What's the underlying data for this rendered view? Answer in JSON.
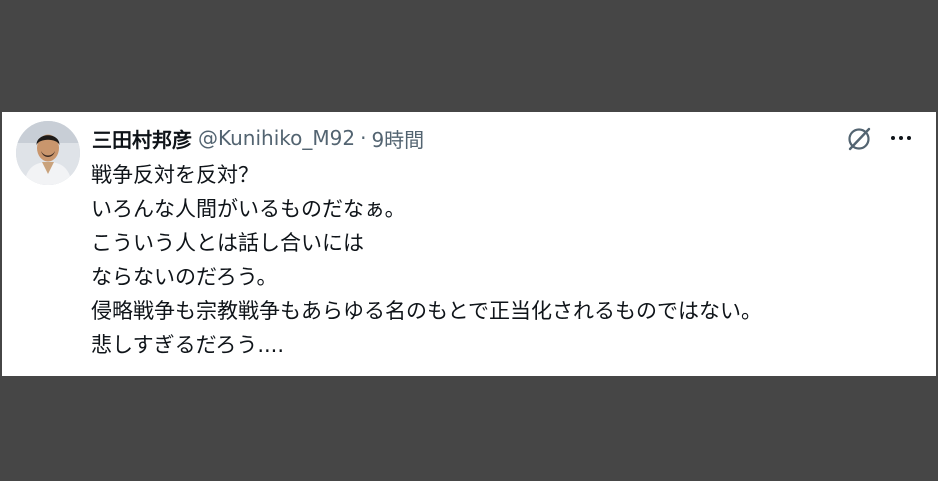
{
  "tweet": {
    "author": {
      "display_name": "三田村邦彦",
      "handle": "@Kunihiko_M92"
    },
    "separator": "·",
    "timestamp": "9時間",
    "lines": [
      "戦争反対を反対？",
      "いろんな人間がいるものだなぁ。",
      "こういう人とは話し合いには",
      "ならないのだろう。",
      "侵略戦争も宗教戦争もあらゆる名のもとで正当化されるものではない。",
      "悲しすぎるだろう...."
    ],
    "icons": {
      "grok": "grok-icon",
      "more": "more-options-icon"
    },
    "colors": {
      "background": "#464646",
      "card": "#ffffff",
      "text": "#0f1419",
      "muted": "#536471"
    }
  }
}
